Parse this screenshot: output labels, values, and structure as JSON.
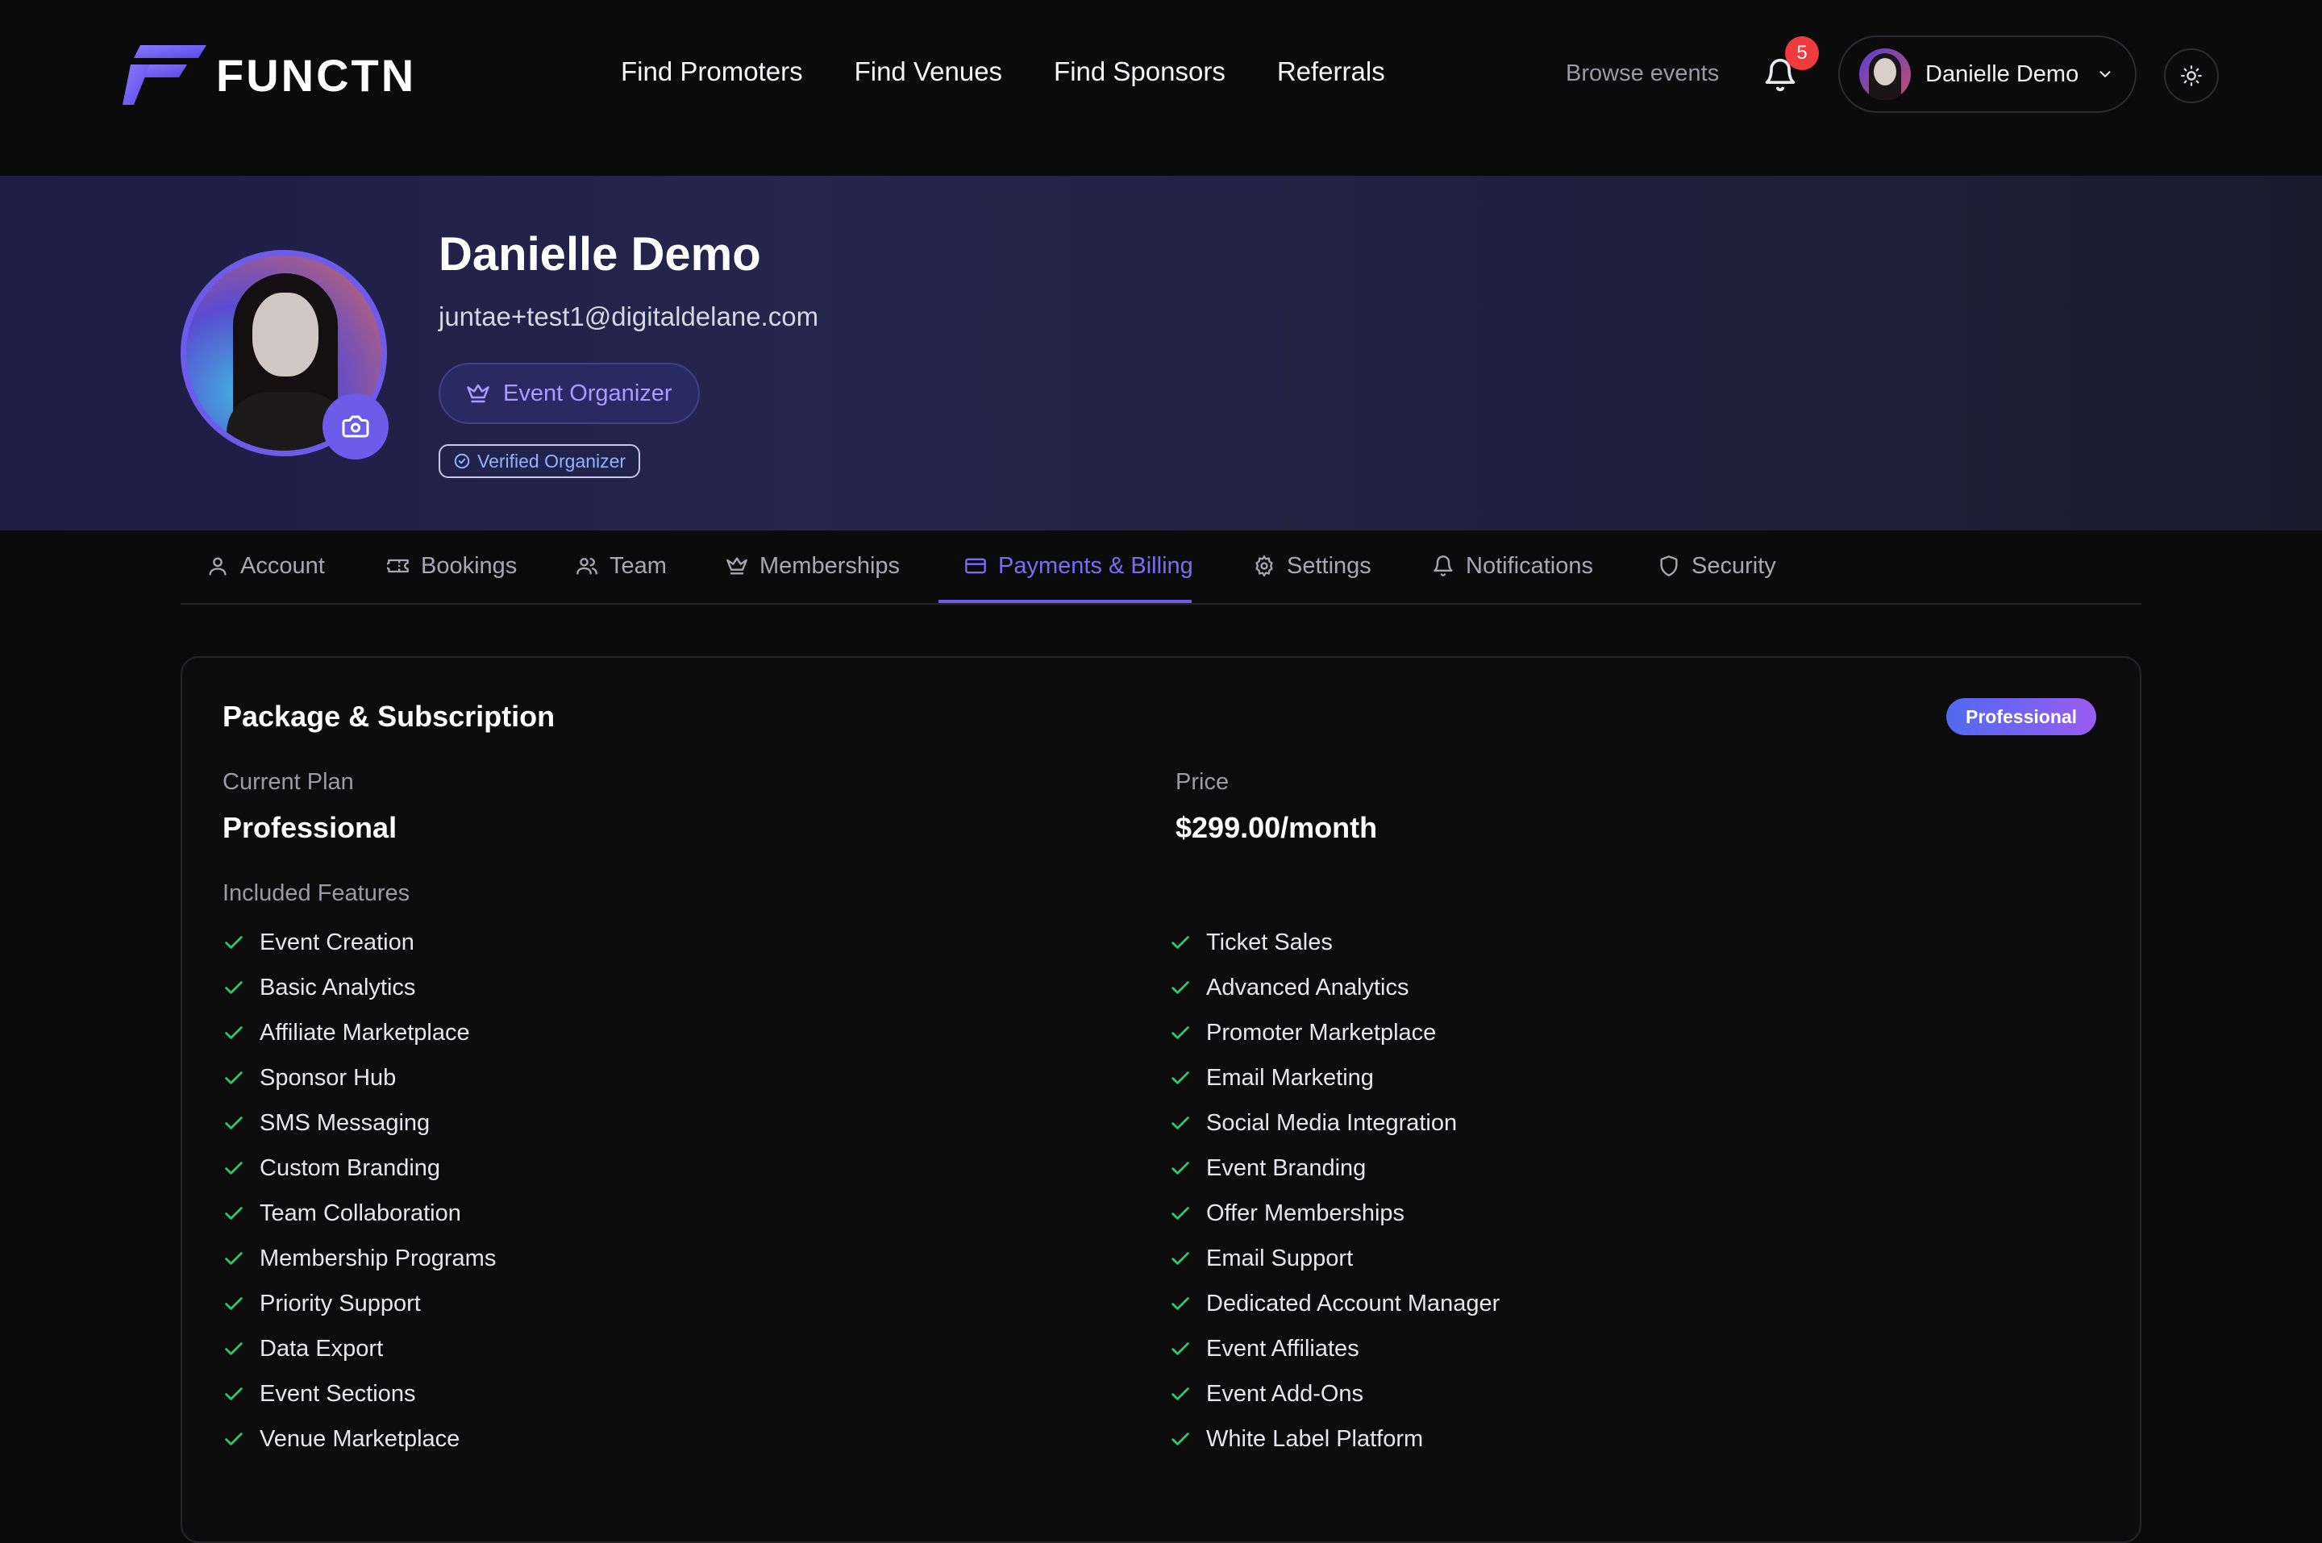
{
  "brand": {
    "name": "FUNCTN",
    "accent": "#6d5bea"
  },
  "nav": {
    "links": [
      "Find Promoters",
      "Find Venues",
      "Find Sponsors",
      "Referrals"
    ],
    "browse": "Browse events",
    "notification_count": "5",
    "user_name": "Danielle Demo"
  },
  "profile": {
    "name": "Danielle Demo",
    "email": "juntae+test1@digitaldelane.com",
    "role": "Event Organizer",
    "verified": "Verified Organizer"
  },
  "tabs": [
    {
      "label": "Account",
      "icon": "user-icon"
    },
    {
      "label": "Bookings",
      "icon": "ticket-icon"
    },
    {
      "label": "Team",
      "icon": "users-icon"
    },
    {
      "label": "Memberships",
      "icon": "crown-icon"
    },
    {
      "label": "Payments & Billing",
      "icon": "credit-card-icon",
      "active": true
    },
    {
      "label": "Settings",
      "icon": "gear-icon"
    },
    {
      "label": "Notifications",
      "icon": "bell-icon"
    },
    {
      "label": "Security",
      "icon": "shield-icon"
    }
  ],
  "subscription": {
    "title": "Package & Subscription",
    "badge": "Professional",
    "current_plan_label": "Current Plan",
    "current_plan": "Professional",
    "price_label": "Price",
    "price": "$299.00/month",
    "features_label": "Included Features",
    "features_left": [
      "Event Creation",
      "Basic Analytics",
      "Affiliate Marketplace",
      "Sponsor Hub",
      "SMS Messaging",
      "Custom Branding",
      "Team Collaboration",
      "Membership Programs",
      "Priority Support",
      "Data Export",
      "Event Sections",
      "Venue Marketplace"
    ],
    "features_right": [
      "Ticket Sales",
      "Advanced Analytics",
      "Promoter Marketplace",
      "Email Marketing",
      "Social Media Integration",
      "Event Branding",
      "Offer Memberships",
      "Email Support",
      "Dedicated Account Manager",
      "Event Affiliates",
      "Event Add-Ons",
      "White Label Platform"
    ]
  }
}
